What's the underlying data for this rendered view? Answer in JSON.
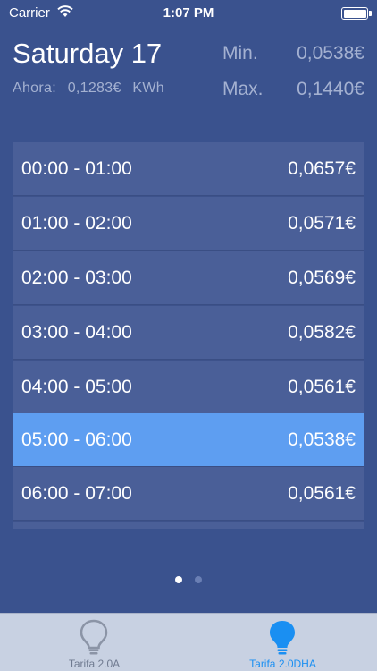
{
  "status_bar": {
    "carrier": "Carrier",
    "time": "1:07 PM",
    "icons": [
      "wifi-icon",
      "battery-icon"
    ]
  },
  "header": {
    "day": "Saturday 17",
    "now_label": "Ahora:",
    "now_value": "0,1283€",
    "now_unit": "KWh",
    "min_label": "Min.",
    "min_value": "0,0538€",
    "max_label": "Max.",
    "max_value": "0,1440€"
  },
  "hours": [
    {
      "range": "00:00 - 01:00",
      "price": "0,0657€",
      "selected": false
    },
    {
      "range": "01:00 - 02:00",
      "price": "0,0571€",
      "selected": false
    },
    {
      "range": "02:00 - 03:00",
      "price": "0,0569€",
      "selected": false
    },
    {
      "range": "03:00 - 04:00",
      "price": "0,0582€",
      "selected": false
    },
    {
      "range": "04:00 - 05:00",
      "price": "0,0561€",
      "selected": false
    },
    {
      "range": "05:00 - 06:00",
      "price": "0,0538€",
      "selected": true
    },
    {
      "range": "06:00 - 07:00",
      "price": "0,0561€",
      "selected": false
    }
  ],
  "page_indicator": {
    "pages": 2,
    "current": 1
  },
  "tabs": [
    {
      "label": "Tarifa 2.0A",
      "icon": "lightbulb-icon",
      "active": false
    },
    {
      "label": "Tarifa 2.0DHA",
      "icon": "lightbulb-icon",
      "active": true
    }
  ],
  "colors": {
    "background": "#3a528e",
    "row": "#4a5f98",
    "selected_row": "#5e9ef1",
    "tab_active": "#1a8ff2",
    "tab_inactive": "#6f7a90"
  }
}
